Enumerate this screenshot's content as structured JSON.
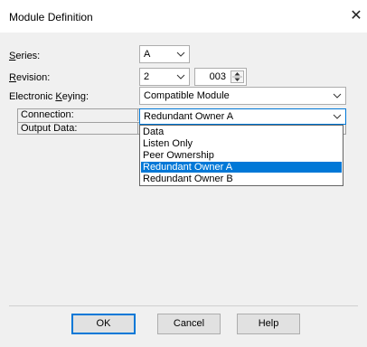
{
  "window": {
    "title": "Module Definition",
    "close_glyph": "✕"
  },
  "fields": {
    "series": {
      "label_underline": "S",
      "label_rest": "eries:",
      "value": "A"
    },
    "revision": {
      "label_underline": "R",
      "label_rest": "evision:",
      "major": "2",
      "minor": "003"
    },
    "keying": {
      "label_pre": "Electronic ",
      "label_underline": "K",
      "label_rest": "eying:",
      "value": "Compatible Module"
    }
  },
  "grid": {
    "rows": [
      {
        "label": "Connection:",
        "value": "Redundant Owner A"
      },
      {
        "label": "Output Data:",
        "value": ""
      }
    ]
  },
  "connection_options": [
    "Data",
    "Listen Only",
    "Peer Ownership",
    "Redundant Owner A",
    "Redundant Owner B"
  ],
  "connection_selected_index": 3,
  "buttons": {
    "ok": "OK",
    "cancel": "Cancel",
    "help": "Help"
  },
  "colors": {
    "selection": "#0078d7",
    "dialog_bg": "#f0f0f0"
  }
}
